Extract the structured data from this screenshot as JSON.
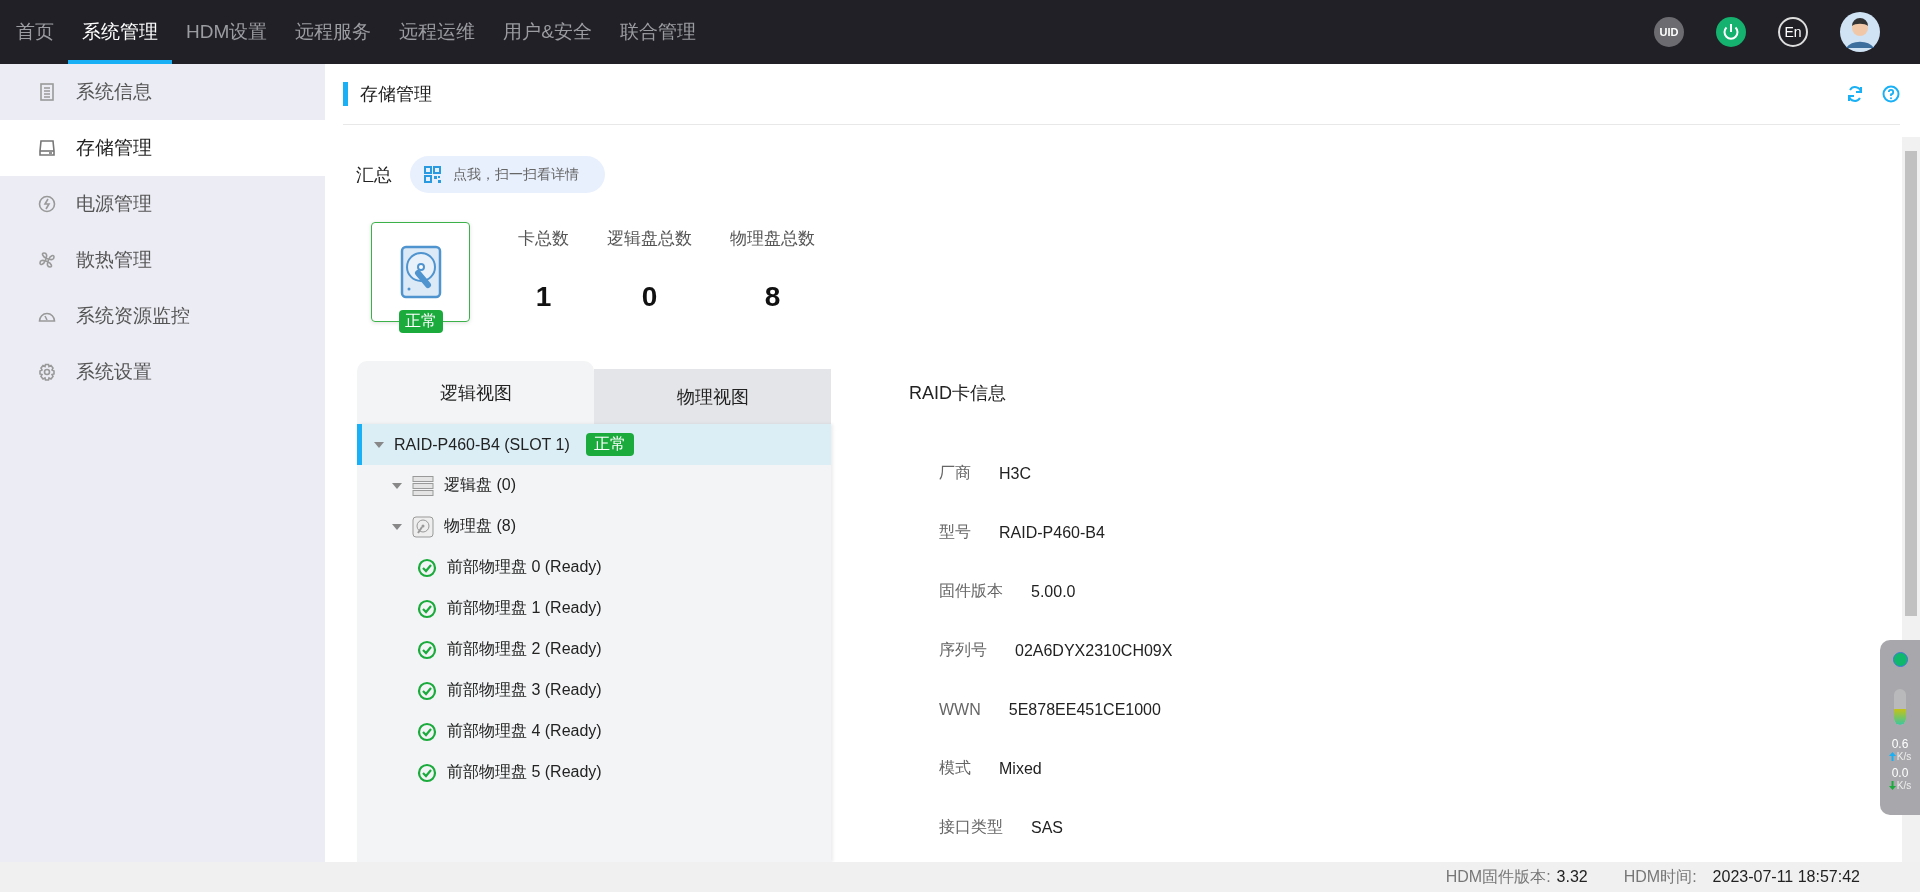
{
  "top_nav": {
    "tabs": [
      {
        "label": "首页",
        "selected": false
      },
      {
        "label": "系统管理",
        "selected": true
      },
      {
        "label": "HDM设置",
        "selected": false
      },
      {
        "label": "远程服务",
        "selected": false
      },
      {
        "label": "远程运维",
        "selected": false
      },
      {
        "label": "用户&安全",
        "selected": false
      },
      {
        "label": "联合管理",
        "selected": false
      }
    ],
    "uid_label": "UID",
    "lang_label": "En"
  },
  "sidebar": {
    "items": [
      {
        "label": "系统信息",
        "kind": "list",
        "selected": false
      },
      {
        "label": "存储管理",
        "kind": "drive",
        "selected": true
      },
      {
        "label": "电源管理",
        "kind": "power",
        "selected": false
      },
      {
        "label": "散热管理",
        "kind": "fan",
        "selected": false
      },
      {
        "label": "系统资源监控",
        "kind": "gauge",
        "selected": false
      },
      {
        "label": "系统设置",
        "kind": "gear",
        "selected": false
      }
    ]
  },
  "page_title": "存储管理",
  "summary": {
    "title": "汇总",
    "scan_hint": "点我，扫一扫看详情",
    "status": "正常",
    "stats": [
      {
        "label": "卡总数",
        "value": "1"
      },
      {
        "label": "逻辑盘总数",
        "value": "0"
      },
      {
        "label": "物理盘总数",
        "value": "8"
      }
    ]
  },
  "view_tabs": [
    {
      "label": "逻辑视图",
      "selected": true
    },
    {
      "label": "物理视图",
      "selected": false
    }
  ],
  "tree": [
    {
      "label": "RAID-P460-B4 (SLOT 1)",
      "badge": "正常",
      "kind": "card",
      "selected": true,
      "expanded": true,
      "children": [
        {
          "label": "逻辑盘 (0)",
          "kind": "logical",
          "selected": false,
          "expanded": true
        },
        {
          "label": "物理盘 (8)",
          "kind": "physical",
          "selected": false,
          "expanded": true,
          "children": [
            {
              "label": "前部物理盘 0 (Ready)",
              "kind": "disk",
              "selected": false
            },
            {
              "label": "前部物理盘 1 (Ready)",
              "kind": "disk",
              "selected": false
            },
            {
              "label": "前部物理盘 2 (Ready)",
              "kind": "disk",
              "selected": false
            },
            {
              "label": "前部物理盘 3 (Ready)",
              "kind": "disk",
              "selected": false
            },
            {
              "label": "前部物理盘 4 (Ready)",
              "kind": "disk",
              "selected": false
            },
            {
              "label": "前部物理盘 5 (Ready)",
              "kind": "disk",
              "selected": false
            }
          ]
        }
      ]
    }
  ],
  "raid_info": {
    "title": "RAID卡信息",
    "fields": [
      {
        "label": "厂商",
        "value": "H3C"
      },
      {
        "label": "型号",
        "value": "RAID-P460-B4"
      },
      {
        "label": "固件版本",
        "value": "5.00.0"
      },
      {
        "label": "序列号",
        "value": "02A6DYX2310CH09X"
      },
      {
        "label": "WWN",
        "value": "5E878EE451CE1000"
      },
      {
        "label": "模式",
        "value": "Mixed"
      },
      {
        "label": "接口类型",
        "value": "SAS"
      }
    ]
  },
  "monitor_widget": {
    "meter": {
      "level": 0.45
    },
    "upload": "0.6",
    "download": "0.0",
    "unit_up": "K/s",
    "unit_down": "K/s"
  },
  "status_bar": {
    "firmware_label": "HDM固件版本:",
    "firmware_value": "3.32",
    "time_label": "HDM时间:",
    "time_value": "2023-07-11 18:57:42"
  }
}
